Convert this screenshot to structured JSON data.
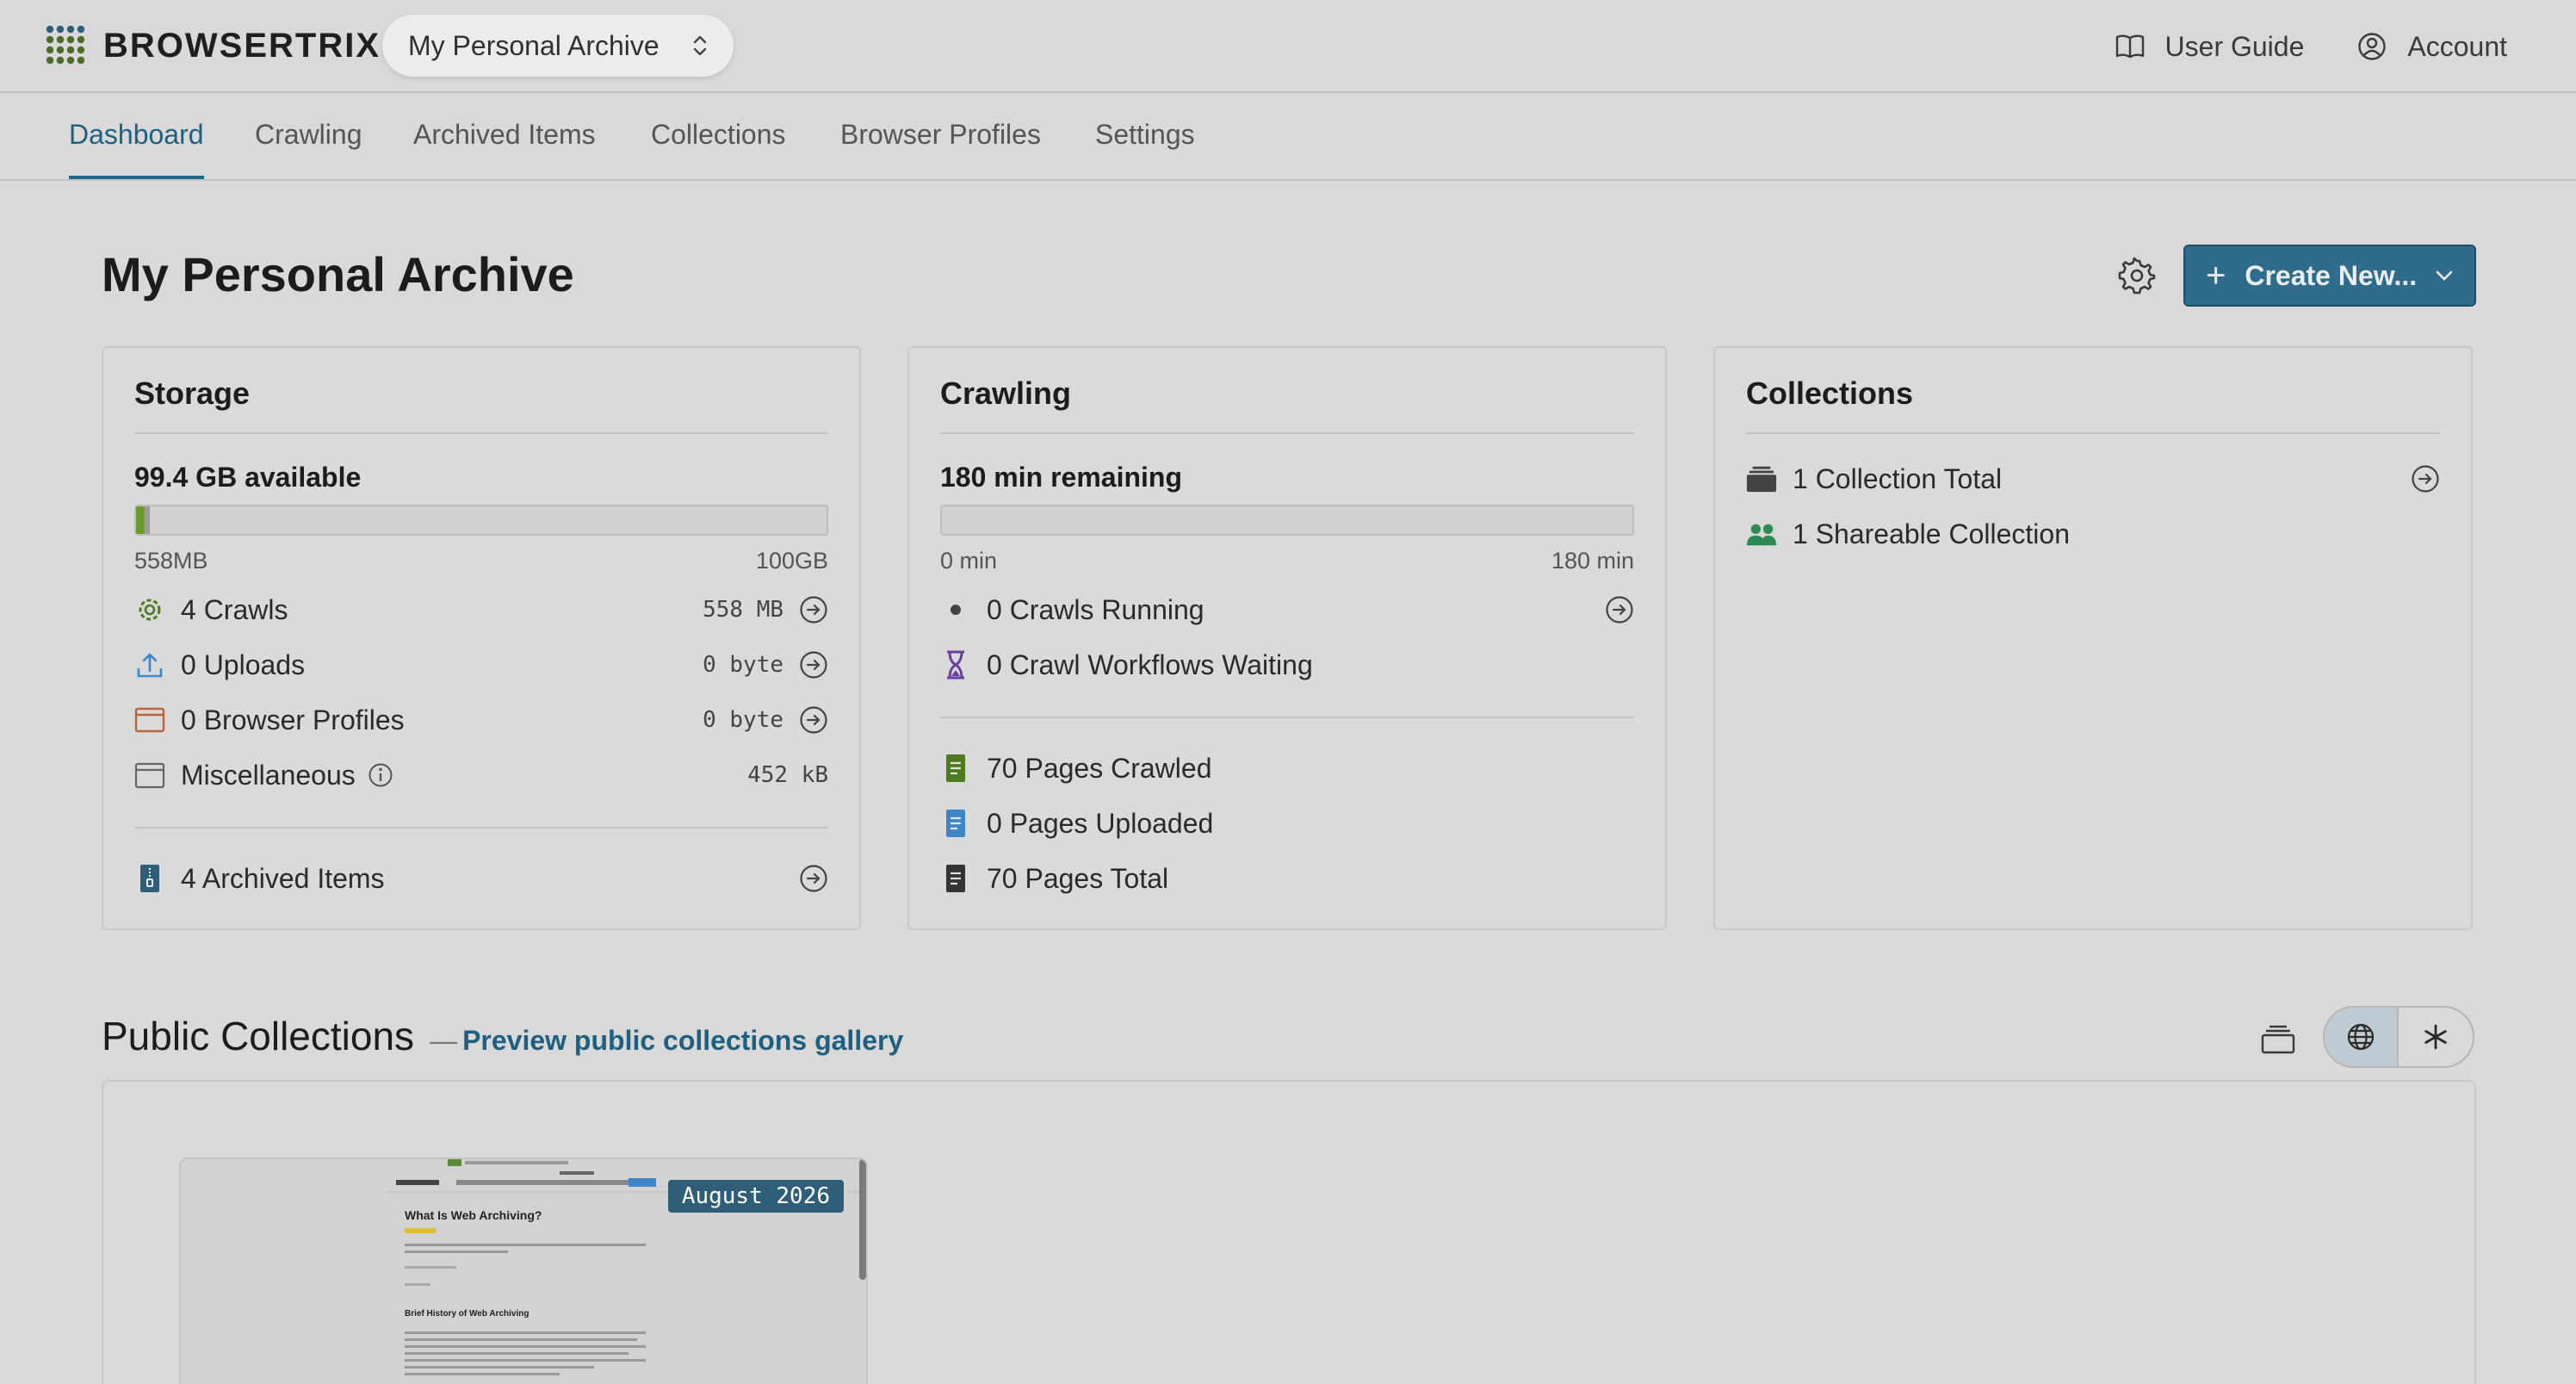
{
  "app": {
    "name": "BROWSERTRIX"
  },
  "org_selector": {
    "label": "My Personal Archive"
  },
  "top_links": {
    "guide": "User Guide",
    "account": "Account"
  },
  "nav": {
    "tabs": [
      {
        "label": "Dashboard",
        "active": true
      },
      {
        "label": "Crawling"
      },
      {
        "label": "Archived Items"
      },
      {
        "label": "Collections"
      },
      {
        "label": "Browser Profiles"
      },
      {
        "label": "Settings"
      }
    ]
  },
  "page": {
    "title": "My Personal Archive",
    "create_label": "Create New..."
  },
  "storage": {
    "title": "Storage",
    "available": "99.4 GB available",
    "used_label": "558MB",
    "max_label": "100GB",
    "used_fraction": 0.0056,
    "rows": [
      {
        "label": "4 Crawls",
        "size": "558 MB",
        "icon": "gear-icon",
        "link": true
      },
      {
        "label": "0 Uploads",
        "size": "0 byte",
        "icon": "upload-icon",
        "link": true
      },
      {
        "label": "0 Browser Profiles",
        "size": "0 byte",
        "icon": "browser-window-icon",
        "link": true
      },
      {
        "label": "Miscellaneous",
        "size": "452 kB",
        "icon": "archive-box-icon",
        "link": false
      }
    ],
    "archived_items": "4 Archived Items"
  },
  "crawling": {
    "title": "Crawling",
    "remaining": "180 min remaining",
    "min_label": "0 min",
    "max_label": "180 min",
    "used_fraction": 0,
    "running": "0 Crawls Running",
    "waiting": "0 Crawl Workflows Waiting",
    "pages_crawled": "70 Pages Crawled",
    "pages_uploaded": "0 Pages Uploaded",
    "pages_total": "70 Pages Total"
  },
  "collections": {
    "title": "Collections",
    "total": "1 Collection Total",
    "shareable": "1 Shareable Collection"
  },
  "public_collections": {
    "title": "Public Collections",
    "dash": "—",
    "link": "Preview public collections gallery",
    "items": [
      {
        "badge": "August 2026",
        "preview_title": "What Is Web Archiving?",
        "preview_heading": "Brief History of Web Archiving"
      }
    ]
  },
  "colors": {
    "accent": "#2f6b8a",
    "storage_crawls": "#6a8c2a",
    "storage_uploads": "#3f86c8",
    "storage_profiles": "#b8643a"
  }
}
